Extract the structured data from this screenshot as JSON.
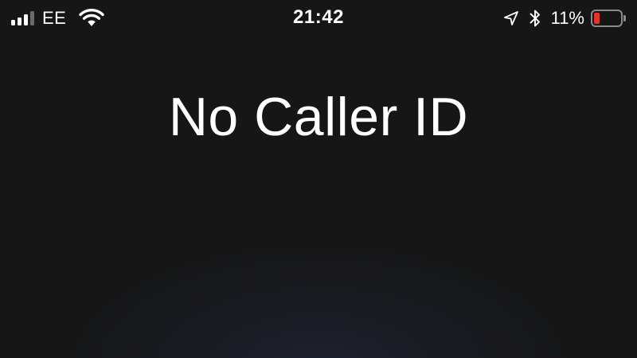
{
  "status_bar": {
    "carrier": "EE",
    "time": "21:42",
    "battery_percent_label": "11%",
    "battery_level": 0.11,
    "battery_color": "#e5322b",
    "signal_bars_active": 3,
    "signal_bars_total": 4,
    "icons": [
      "signal-icon",
      "wifi-icon",
      "location-icon",
      "bluetooth-icon",
      "battery-icon"
    ]
  },
  "call": {
    "caller_name": "No Caller ID"
  },
  "colors": {
    "background": "#161616",
    "text": "#ffffff"
  }
}
